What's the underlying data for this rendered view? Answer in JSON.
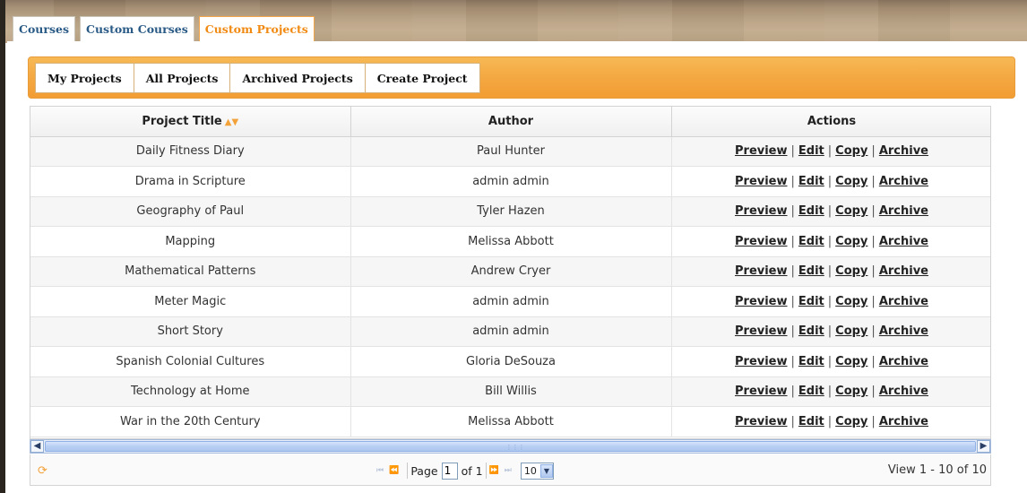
{
  "tabs": [
    {
      "label": "Courses",
      "active": false
    },
    {
      "label": "Custom Courses",
      "active": false
    },
    {
      "label": "Custom Projects",
      "active": true
    }
  ],
  "toolbar": {
    "buttons": [
      "My Projects",
      "All Projects",
      "Archived Projects",
      "Create Project"
    ]
  },
  "grid": {
    "columns": [
      "Project Title",
      "Author",
      "Actions"
    ],
    "sort_indicator": "▲▼",
    "rows": [
      {
        "title": "Daily Fitness Diary",
        "author": "Paul Hunter"
      },
      {
        "title": "Drama in Scripture",
        "author": "admin admin"
      },
      {
        "title": "Geography of Paul",
        "author": "Tyler Hazen"
      },
      {
        "title": "Mapping",
        "author": "Melissa Abbott"
      },
      {
        "title": "Mathematical Patterns",
        "author": "Andrew Cryer"
      },
      {
        "title": "Meter Magic",
        "author": "admin admin"
      },
      {
        "title": "Short Story",
        "author": "admin admin"
      },
      {
        "title": "Spanish Colonial Cultures",
        "author": "Gloria DeSouza"
      },
      {
        "title": "Technology at Home",
        "author": "Bill Willis"
      },
      {
        "title": "War in the 20th Century",
        "author": "Melissa Abbott"
      }
    ],
    "actions": [
      "Preview",
      "Edit",
      "Copy",
      "Archive"
    ],
    "separator": "|"
  },
  "pager": {
    "page_label": "Page",
    "page_value": "1",
    "of_label": "of 1",
    "rows_per_page": "10",
    "view_info": "View 1 - 10 of 10"
  },
  "colors": {
    "accent": "#f4a842",
    "tab_text": "#2a5a86",
    "active_tab_text": "#f08a13"
  }
}
